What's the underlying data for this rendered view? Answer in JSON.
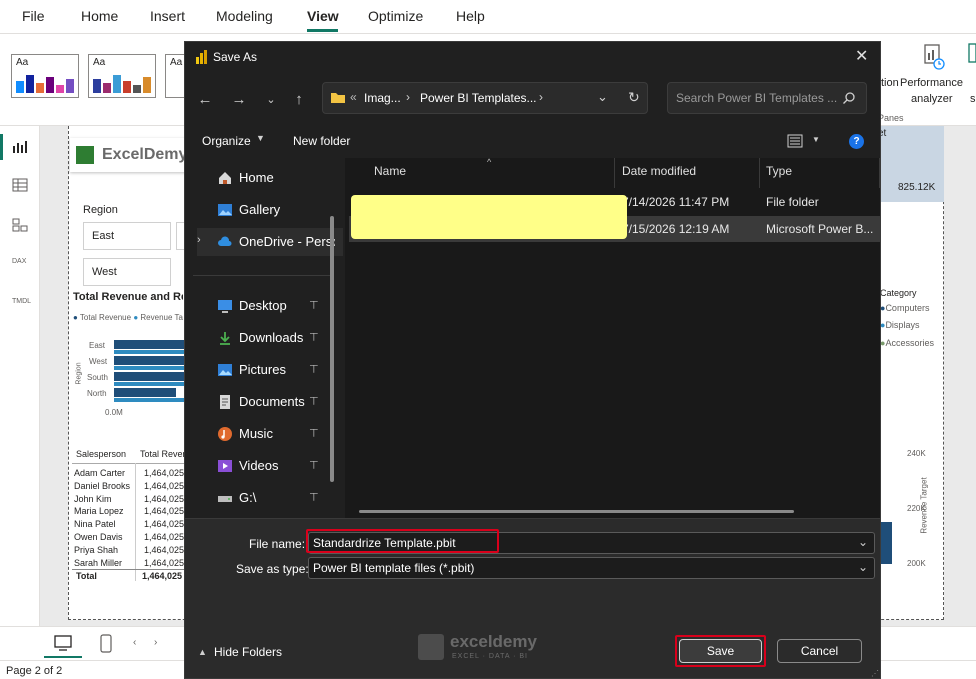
{
  "menubar": {
    "items": [
      "File",
      "Home",
      "Insert",
      "Modeling",
      "View",
      "Optimize",
      "Help"
    ],
    "active": "View"
  },
  "ribbon": {
    "right_label_1": "tion",
    "performance_label": "Performance",
    "analyzer_label": "analyzer",
    "panes_label": "Panes",
    "theme_label": "Aa"
  },
  "report": {
    "logo_text": "ExcelDemy",
    "region_label": "Region",
    "slicer_items": [
      "East",
      "West"
    ],
    "chart_title": "Total Revenue and Re",
    "legend": [
      "Total Revenue",
      "Revenue Ta"
    ],
    "regions": [
      "East",
      "West",
      "South",
      "North"
    ],
    "axis_region": "Region",
    "axis_zero": "0.0M",
    "table_headers": [
      "Salesperson",
      "Total Reven"
    ],
    "table_rows": [
      {
        "name": "Adam Carter",
        "value": "1,464,025"
      },
      {
        "name": "Daniel Brooks",
        "value": "1,464,025"
      },
      {
        "name": "John Kim",
        "value": "1,464,025"
      },
      {
        "name": "Maria Lopez",
        "value": "1,464,025"
      },
      {
        "name": "Nina Patel",
        "value": "1,464,025"
      },
      {
        "name": "Owen Davis",
        "value": "1,464,025"
      },
      {
        "name": "Priya Shah",
        "value": "1,464,025"
      },
      {
        "name": "Sarah Miller",
        "value": "1,464,025"
      }
    ],
    "table_total_label": "Total",
    "table_total_value": "1,464,025",
    "card_label": "et",
    "card_value": "825.12K",
    "category_label": "Category",
    "categories": [
      "Computers",
      "Displays",
      "Accessories"
    ],
    "y_ticks": [
      "240K",
      "220K",
      "200K"
    ],
    "y_axis_label": "Revenue Target"
  },
  "statusbar": {
    "page": "Page 2 of 2"
  },
  "dialog": {
    "title": "Save As",
    "breadcrumb_prefix": "«",
    "breadcrumb_1": "Imag...",
    "breadcrumb_2": "Power BI Templates...",
    "search_placeholder": "Search Power BI Templates ...",
    "organize_label": "Organize",
    "new_folder_label": "New folder",
    "nav_items": [
      {
        "label": "Home",
        "icon": "home-icon"
      },
      {
        "label": "Gallery",
        "icon": "gallery-icon"
      },
      {
        "label": "OneDrive - Perso",
        "icon": "cloud-icon"
      },
      {
        "label": "Desktop",
        "icon": "desktop-icon"
      },
      {
        "label": "Downloads",
        "icon": "download-icon"
      },
      {
        "label": "Pictures",
        "icon": "pictures-icon"
      },
      {
        "label": "Documents",
        "icon": "documents-icon"
      },
      {
        "label": "Music",
        "icon": "music-icon"
      },
      {
        "label": "Videos",
        "icon": "videos-icon"
      },
      {
        "label": "G:\\",
        "icon": "drive-icon"
      }
    ],
    "columns": {
      "name": "Name",
      "date": "Date modified",
      "type": "Type"
    },
    "files": [
      {
        "name": "",
        "date": "7/14/2026 11:47 PM",
        "type": "File folder"
      },
      {
        "name": "",
        "date": "7/15/2026 12:19 AM",
        "type": "Microsoft Power B..."
      }
    ],
    "file_name_label": "File name:",
    "file_name_value": "Standardrize Template.pbit",
    "save_type_label": "Save as type:",
    "save_type_value": "Power BI template files (*.pbit)",
    "hide_folders_label": "Hide Folders",
    "save_label": "Save",
    "cancel_label": "Cancel",
    "watermark_name": "exceldemy",
    "watermark_tag": "EXCEL · DATA · BI"
  }
}
